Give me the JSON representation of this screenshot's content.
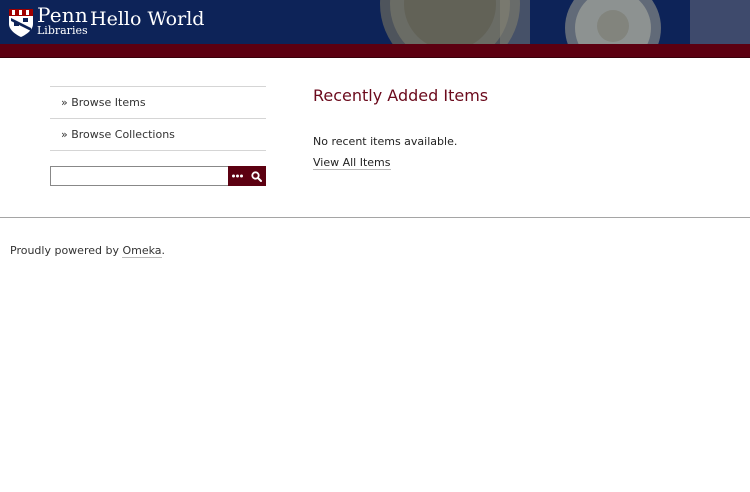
{
  "header": {
    "logo_main": "Penn",
    "logo_sub": "Libraries",
    "site_title": "Hello World",
    "bg_color": "#0d2358",
    "bar_color": "#5c0011"
  },
  "sidebar": {
    "items": [
      {
        "label": "» Browse Items"
      },
      {
        "label": "» Browse Collections"
      }
    ],
    "search": {
      "value": "",
      "advanced_icon": "ellipsis-icon",
      "submit_icon": "search-icon"
    }
  },
  "main": {
    "heading": "Recently Added Items",
    "empty_message": "No recent items available.",
    "view_all_label": "View All Items",
    "heading_color": "#6b0a1c"
  },
  "footer": {
    "prefix": "Proudly powered by",
    "link_label": "Omeka",
    "suffix": "."
  }
}
